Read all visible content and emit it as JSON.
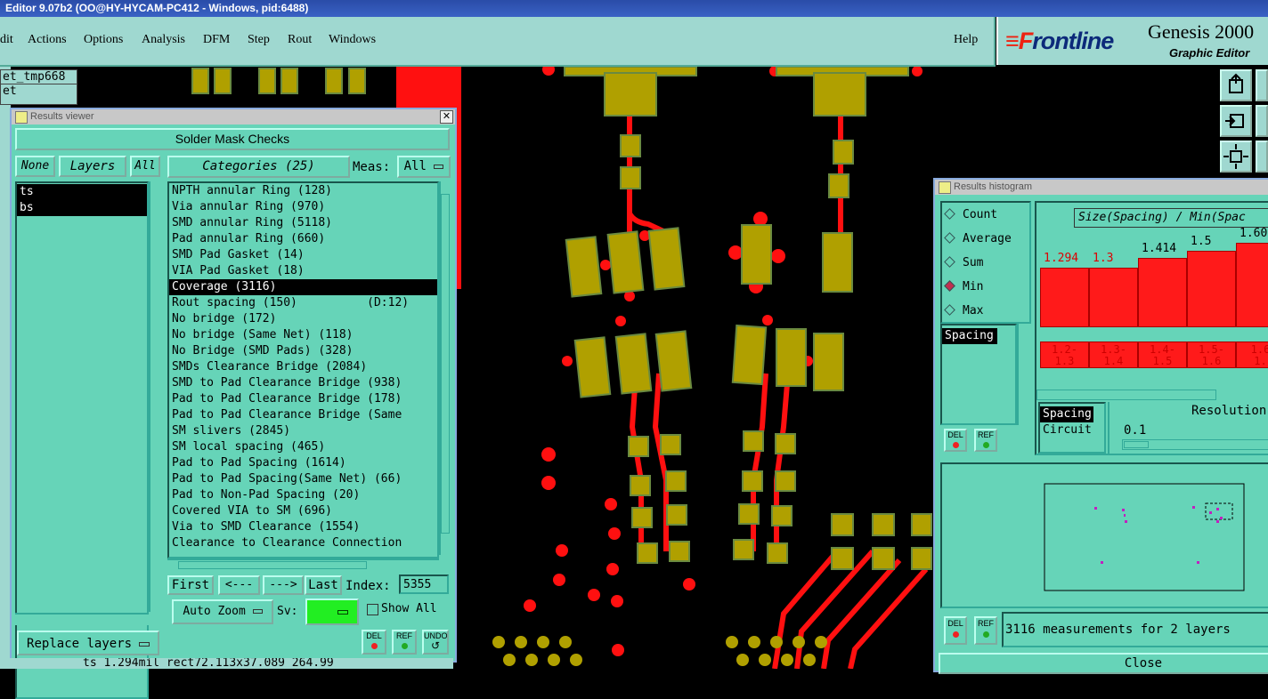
{
  "window": {
    "title": "Editor 9.07b2 (OO@HY-HYCAM-PC412 - Windows, pid:6488)"
  },
  "menu": {
    "items": [
      "dit",
      "Actions",
      "Options",
      "Analysis",
      "DFM",
      "Step",
      "Rout",
      "Windows"
    ],
    "help": "Help"
  },
  "brand": {
    "logo_f": "≡F",
    "logo_rest": "rontline",
    "product": "Genesis 2000",
    "subtitle": "Graphic Editor"
  },
  "job": {
    "line1": "et_tmp668",
    "line2": "et"
  },
  "results_viewer": {
    "title": "Results viewer",
    "heading": "Solder Mask Checks",
    "none_label": "None",
    "layers_label": "Layers",
    "all_label": "All",
    "layers": [
      "ts",
      "bs"
    ],
    "categories_label": "Categories (25)",
    "meas_label": "Meas:",
    "meas_value": "All",
    "categories": [
      "NPTH annular Ring (128)",
      "Via annular Ring (970)",
      "SMD annular Ring (5118)",
      "Pad annular Ring (660)",
      "SMD Pad Gasket (14)",
      "VIA Pad Gasket (18)",
      "Coverage (3116)",
      "Rout spacing (150)          (D:12)",
      "No bridge (172)",
      "No bridge (Same Net) (118)",
      "No Bridge (SMD Pads) (328)",
      "SMDs Clearance Bridge (2084)",
      "SMD to Pad Clearance Bridge (938)",
      "Pad to Pad Clearance Bridge (178)",
      "Pad to Pad Clearance Bridge (Same",
      "SM slivers (2845)",
      "SM local spacing (465)",
      "Pad to Pad Spacing (1614)",
      "Pad to Pad Spacing(Same Net) (66)",
      "Pad to Non-Pad Spacing (20)",
      "Covered VIA to SM (696)",
      "Via to SMD Clearance (1554)",
      "Clearance to Clearance Connection"
    ],
    "selected_index": 6,
    "first_label": "First",
    "prev_label": "<---",
    "next_label": "--->",
    "last_label": "Last",
    "index_label": "Index:",
    "index_value": "5355",
    "zoom_label": "Auto Zoom",
    "sv_label": "Sv:",
    "show_all_label": "Show All",
    "replace_label": "Replace layers",
    "del_label": "DEL",
    "ref_label": "REF",
    "undo_label": "UNDO"
  },
  "status": {
    "text": "ts 1.294mil  rect72.113x37.089 264.99"
  },
  "histogram": {
    "title": "Results histogram",
    "modes": [
      {
        "label": "Count",
        "selected": false
      },
      {
        "label": "Average",
        "selected": false
      },
      {
        "label": "Sum",
        "selected": false
      },
      {
        "label": "Min",
        "selected": true
      },
      {
        "label": "Max",
        "selected": false
      }
    ],
    "list_item": "Spacing",
    "header": "Size(Spacing) / Min(Spac",
    "bars": [
      {
        "value": "1.294",
        "range": "1.2- 1.3",
        "level": 0.35,
        "red": true
      },
      {
        "value": "1.3",
        "range": "1.3- 1.4",
        "level": 0.35,
        "red": true
      },
      {
        "value": "1.414",
        "range": "1.4- 1.5",
        "level": 0.41,
        "red": false
      },
      {
        "value": "1.5",
        "range": "1.5- 1.6",
        "level": 0.45,
        "red": false
      },
      {
        "value": "1.60",
        "range": "1.6 1.",
        "level": 0.5,
        "red": false
      }
    ],
    "type_items": [
      "Spacing",
      "Circuit"
    ],
    "resolution_label": "Resolution",
    "resolution_value": "0.1",
    "summary": "3116 measurements for 2 layers",
    "close_label": "Close",
    "del_label": "DEL",
    "ref_label": "REF"
  }
}
